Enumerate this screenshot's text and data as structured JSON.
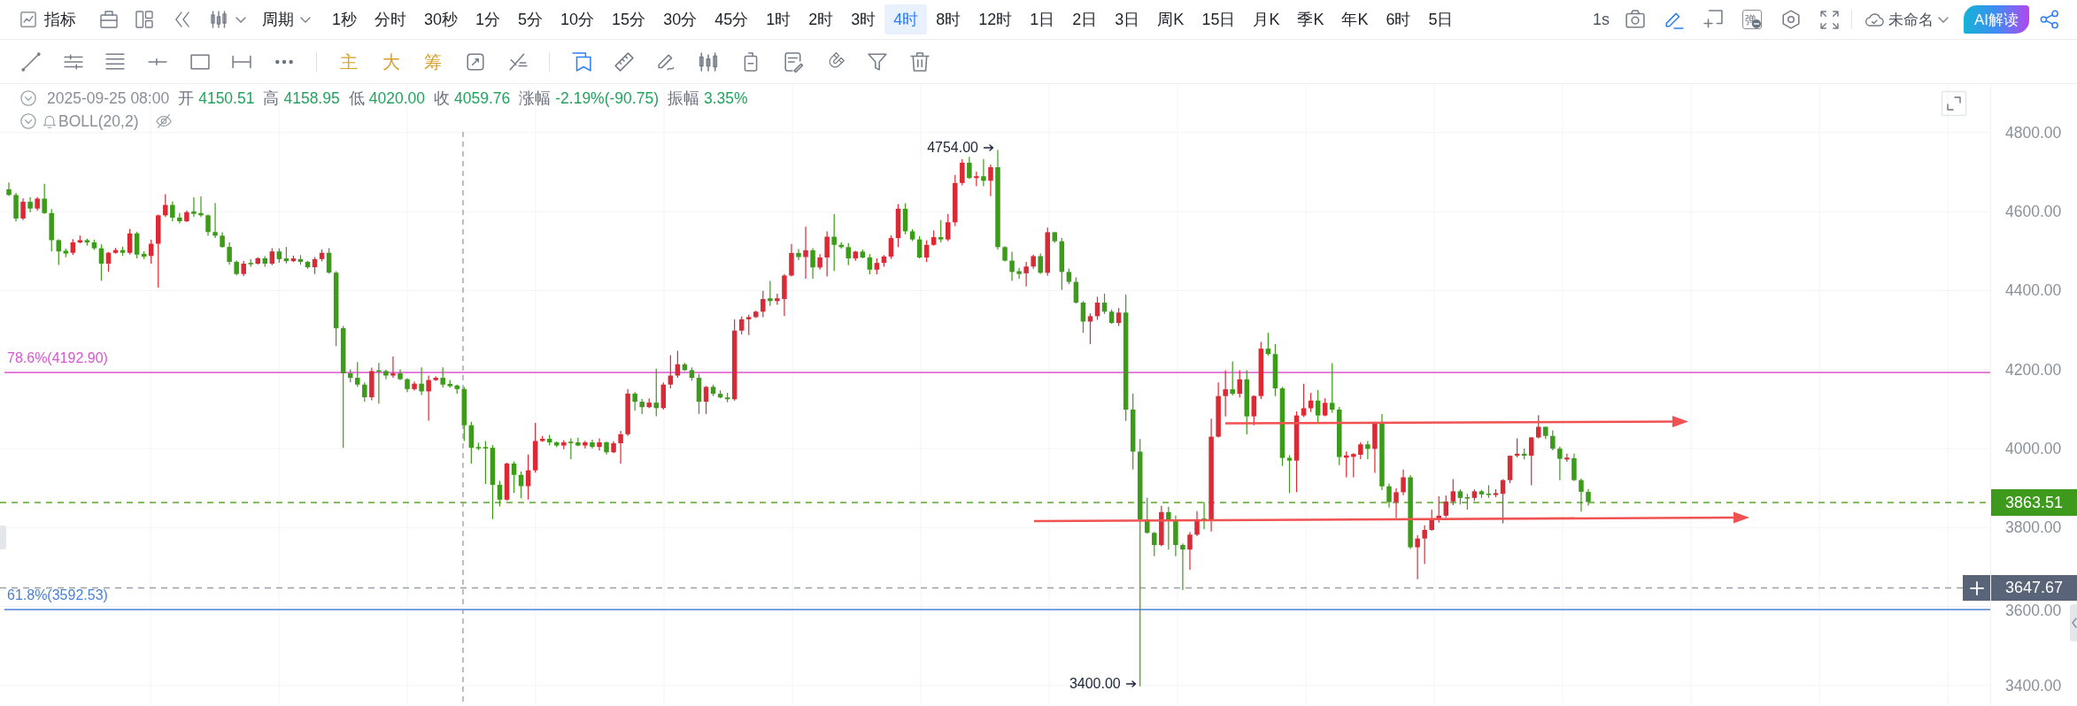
{
  "toolbar": {
    "indicators": "指标",
    "period": "周期",
    "intervals": [
      {
        "label": "1秒",
        "selected": false
      },
      {
        "label": "分时",
        "selected": false
      },
      {
        "label": "30秒",
        "selected": false
      },
      {
        "label": "1分",
        "selected": false
      },
      {
        "label": "5分",
        "selected": false
      },
      {
        "label": "10分",
        "selected": false
      },
      {
        "label": "15分",
        "selected": false
      },
      {
        "label": "30分",
        "selected": false
      },
      {
        "label": "45分",
        "selected": false
      },
      {
        "label": "1时",
        "selected": false
      },
      {
        "label": "2时",
        "selected": false
      },
      {
        "label": "3时",
        "selected": false
      },
      {
        "label": "4时",
        "selected": true
      },
      {
        "label": "8时",
        "selected": false
      },
      {
        "label": "12时",
        "selected": false
      },
      {
        "label": "1日",
        "selected": false
      },
      {
        "label": "2日",
        "selected": false
      },
      {
        "label": "3日",
        "selected": false
      },
      {
        "label": "周K",
        "selected": false
      },
      {
        "label": "15日",
        "selected": false
      },
      {
        "label": "月K",
        "selected": false
      },
      {
        "label": "季K",
        "selected": false
      },
      {
        "label": "年K",
        "selected": false
      },
      {
        "label": "6时",
        "selected": false
      },
      {
        "label": "5日",
        "selected": false
      }
    ],
    "refresh": "1s",
    "danmaku": "弹",
    "layout_name": "未命名",
    "ai_button": "AI解读"
  },
  "drawing_toolbar": {
    "text_tools": [
      "主",
      "大",
      "筹"
    ]
  },
  "info": {
    "datetime": "2025-09-25 08:00",
    "fields": [
      {
        "label": "开",
        "value": "4150.51"
      },
      {
        "label": "高",
        "value": "4158.95"
      },
      {
        "label": "低",
        "value": "4020.00"
      },
      {
        "label": "收",
        "value": "4059.76"
      },
      {
        "label": "涨幅",
        "value": "-2.19%(-90.75)"
      },
      {
        "label": "振幅",
        "value": "3.35%"
      }
    ],
    "indicator": "BOLL(20,2)"
  },
  "chart": {
    "price_labels": [
      "4800.00",
      "4600.00",
      "4400.00",
      "4200.00",
      "4000.00",
      "3800.00",
      "3600.00",
      "3400.00"
    ],
    "levels": [
      {
        "label": "78.6%(4192.90)",
        "color": "#dc55cf"
      },
      {
        "label": "61.8%(3592.53)",
        "color": "#4b80d8"
      }
    ],
    "high_marker": "4754.00",
    "low_marker": "3400.00",
    "last_price": "3863.51",
    "cursor_price": "3647.67"
  }
}
